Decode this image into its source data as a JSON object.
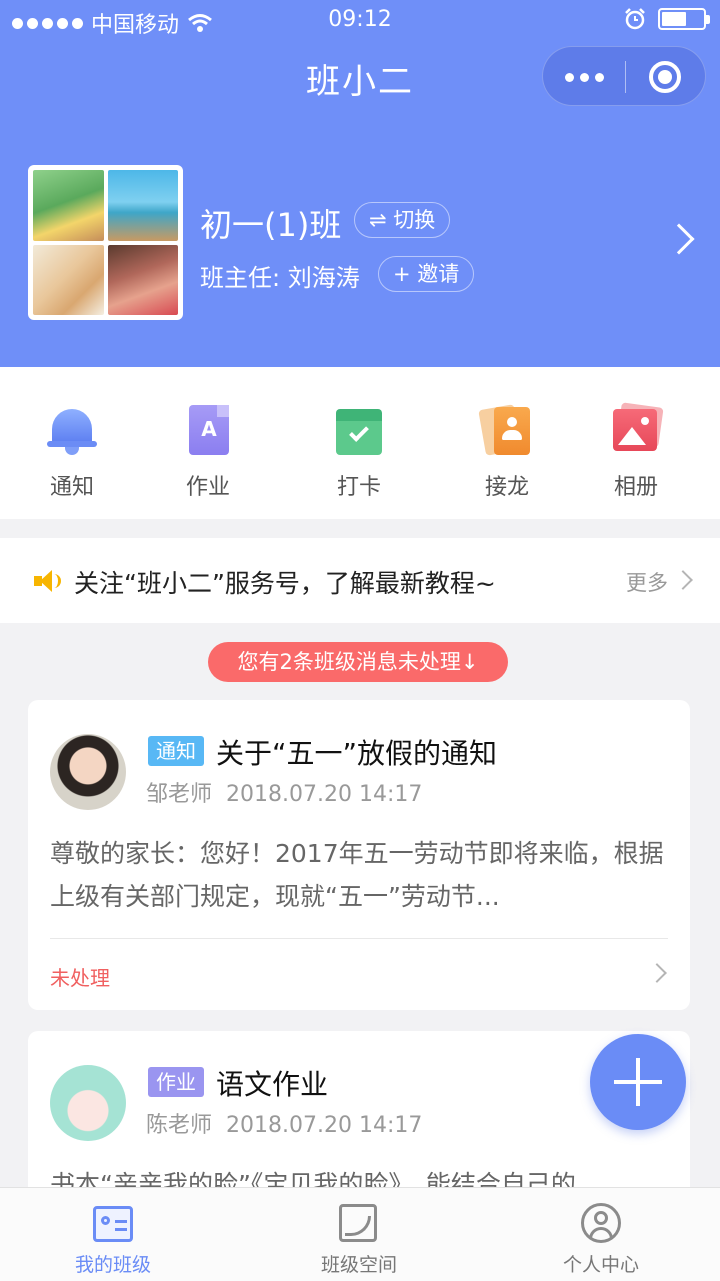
{
  "status_bar": {
    "carrier": "中国移动",
    "time": "09:12",
    "battery_level": 0.6
  },
  "nav": {
    "title": "班小二"
  },
  "class_info": {
    "name": "初一(1)班",
    "switch_label": "⇌ 切换",
    "head_teacher": "班主任: 刘海涛",
    "invite_label": "+ 邀请"
  },
  "menu": {
    "items": [
      {
        "label": "通知",
        "icon": "bell-icon"
      },
      {
        "label": "作业",
        "icon": "document-icon"
      },
      {
        "label": "打卡",
        "icon": "calendar-check-icon"
      },
      {
        "label": "接龙",
        "icon": "relay-cards-icon"
      },
      {
        "label": "相册",
        "icon": "album-icon"
      }
    ]
  },
  "announcement": {
    "text": "关注“班小二”服务号，了解最新教程~",
    "more_label": "更多"
  },
  "alert": {
    "text": "您有2条班级消息未处理↓"
  },
  "feed": [
    {
      "tag": "通知",
      "title": "关于“五一”放假的通知",
      "author": "邹老师",
      "datetime": "2018.07.20 14:17",
      "body": "尊敬的家长：您好！2017年五一劳动节即将来临，根据上级有关部门规定，现就“五一”劳动节...",
      "status": "未处理"
    },
    {
      "tag": "作业",
      "title": "语文作业",
      "author": "陈老师",
      "datetime": "2018.07.20 14:17",
      "body": "书本“亲亲我的脸”《宝贝我的脸》，能结合自己的"
    }
  ],
  "tabbar": {
    "tabs": [
      {
        "label": "我的班级",
        "active": true
      },
      {
        "label": "班级空间",
        "active": false
      },
      {
        "label": "个人中心",
        "active": false
      }
    ]
  },
  "colors": {
    "primary": "#6f8ff8",
    "alert": "#fa6a6a",
    "tag_notice": "#58b8f5",
    "tag_homework": "#9a95f0",
    "unhandled": "#f06060"
  }
}
